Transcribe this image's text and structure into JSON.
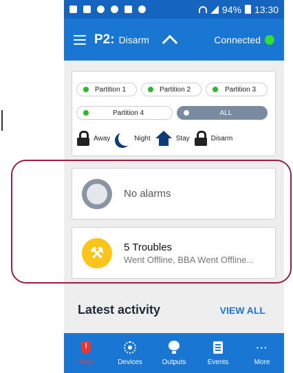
{
  "status_bar": {
    "battery": "94%",
    "time": "13:30"
  },
  "header": {
    "partition_code": "P2:",
    "mode": "Disarm",
    "connection_label": "Connected",
    "connection_color": "#33dd33"
  },
  "partitions": {
    "items": [
      {
        "label": "Partition 1",
        "active": true
      },
      {
        "label": "Partition 2",
        "active": true
      },
      {
        "label": "Partition 3",
        "active": true
      },
      {
        "label": "Partition 4",
        "active": true
      }
    ],
    "all_label": "ALL",
    "all_selected": true
  },
  "arm_modes": {
    "away": "Away",
    "night": "Night",
    "stay": "Stay",
    "disarm": "Disarm"
  },
  "alarms": {
    "text": "No alarms"
  },
  "troubles": {
    "title": "5 Troubles",
    "subtitle": "Went Offline, BBA Went Offline..."
  },
  "activity": {
    "heading": "Latest activity",
    "view_all": "VIEW ALL"
  },
  "nav": {
    "items": [
      {
        "label": "Main",
        "icon": "shield-alert-icon",
        "active": true
      },
      {
        "label": "Devices",
        "icon": "devices-icon",
        "active": false
      },
      {
        "label": "Outputs",
        "icon": "bulb-icon",
        "active": false
      },
      {
        "label": "Events",
        "icon": "events-icon",
        "active": false
      },
      {
        "label": "More",
        "icon": "more-icon",
        "active": false
      }
    ]
  },
  "colors": {
    "primary": "#1976d2",
    "status_bar": "#1565c0",
    "partition_active": "#2db72d",
    "trouble_icon": "#f9c51b",
    "nav_active": "#e53935",
    "highlight_border": "#9b1b46"
  }
}
